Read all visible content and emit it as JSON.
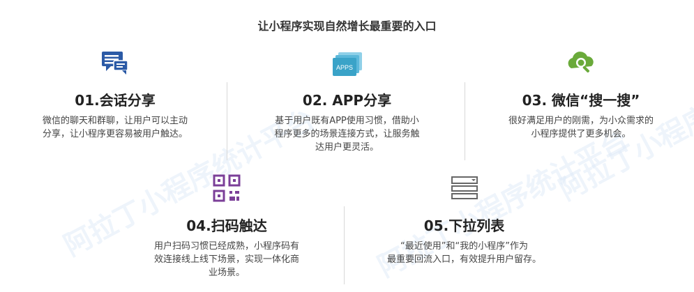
{
  "title": "让小程序实现自然增长最重要的入口",
  "watermark": "阿拉丁小程序统计平台",
  "items": [
    {
      "title": "01.会话分享",
      "desc_lines": [
        "微信的聊天和群聊，让用户可以主动",
        "分享，让小程序更容易被用户触达。"
      ],
      "icon": "chat-icon"
    },
    {
      "title": "02. APP分享",
      "desc_lines": [
        "基于用户既有APP使用习惯，借助小",
        "程序更多的场景连接方式，让服务触",
        "达用户更灵活。"
      ],
      "icon": "apps-icon",
      "icon_label": "APPS"
    },
    {
      "title": "03. 微信“搜一搜”",
      "desc_lines": [
        "很好满足用户的刚需，为小众需求的",
        "小程序提供了更多机会。"
      ],
      "icon": "search-cloud-icon"
    },
    {
      "title": "04.扫码触达",
      "desc_lines": [
        "用户扫码习惯已经成熟，小程序码有",
        "效连接线上线下场景，实现一体化商",
        "业场景。"
      ],
      "icon": "qr-code-icon"
    },
    {
      "title": "05.下拉列表",
      "desc_lines": [
        "“最近使用”和“我的小程序”作为",
        "最重要回流入口，有效提升用户留存。"
      ],
      "icon": "dropdown-list-icon"
    }
  ],
  "colors": {
    "blue": "#2b5aa6",
    "teal": "#3aa3c8",
    "green": "#6aaa3a",
    "purple": "#7b3f98",
    "gray": "#666666"
  }
}
